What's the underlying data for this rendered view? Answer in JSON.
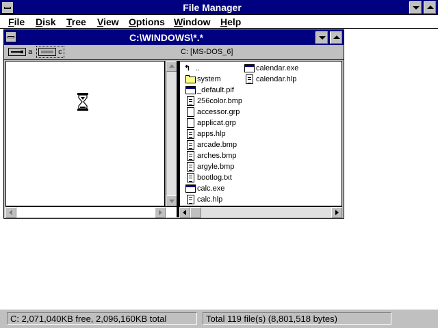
{
  "app": {
    "title": "File Manager",
    "menu": [
      {
        "label": "File",
        "u": "F",
        "rest": "ile"
      },
      {
        "label": "Disk",
        "u": "D",
        "rest": "isk"
      },
      {
        "label": "Tree",
        "u": "T",
        "rest": "ree"
      },
      {
        "label": "View",
        "u": "V",
        "rest": "iew"
      },
      {
        "label": "Options",
        "u": "O",
        "rest": "ptions"
      },
      {
        "label": "Window",
        "u": "W",
        "rest": "indow"
      },
      {
        "label": "Help",
        "u": "H",
        "rest": "elp"
      }
    ]
  },
  "child_window": {
    "title": "C:\\WINDOWS\\*.*",
    "drives": [
      {
        "letter": "a",
        "type": "floppy"
      },
      {
        "letter": "c",
        "type": "hard-disk",
        "selected": true
      }
    ],
    "drive_label": "C: [MS-DOS_6]"
  },
  "files": {
    "items": [
      {
        "name": "..",
        "icon": "up-arrow-icon"
      },
      {
        "name": "system",
        "icon": "folder-icon"
      },
      {
        "name": "_default.pif",
        "icon": "program-icon"
      },
      {
        "name": "256color.bmp",
        "icon": "document-icon"
      },
      {
        "name": "accessor.grp",
        "icon": "file-icon"
      },
      {
        "name": "applicat.grp",
        "icon": "file-icon"
      },
      {
        "name": "apps.hlp",
        "icon": "document-icon"
      },
      {
        "name": "arcade.bmp",
        "icon": "document-icon"
      },
      {
        "name": "arches.bmp",
        "icon": "document-icon"
      },
      {
        "name": "argyle.bmp",
        "icon": "document-icon"
      },
      {
        "name": "bootlog.txt",
        "icon": "document-icon"
      },
      {
        "name": "calc.exe",
        "icon": "program-icon"
      },
      {
        "name": "calc.hlp",
        "icon": "document-icon"
      },
      {
        "name": "calendar.exe",
        "icon": "program-icon"
      },
      {
        "name": "calendar.hlp",
        "icon": "document-icon"
      }
    ]
  },
  "status": {
    "disk": "C: 2,071,040KB free,  2,096,160KB total",
    "files": "Total 119 file(s) (8,801,518 bytes)"
  },
  "icons": {
    "busy": "hourglass-icon"
  },
  "colors": {
    "titlebar": "#000080",
    "window_bg": "#c0c0c0",
    "folder": "#ffff80"
  }
}
